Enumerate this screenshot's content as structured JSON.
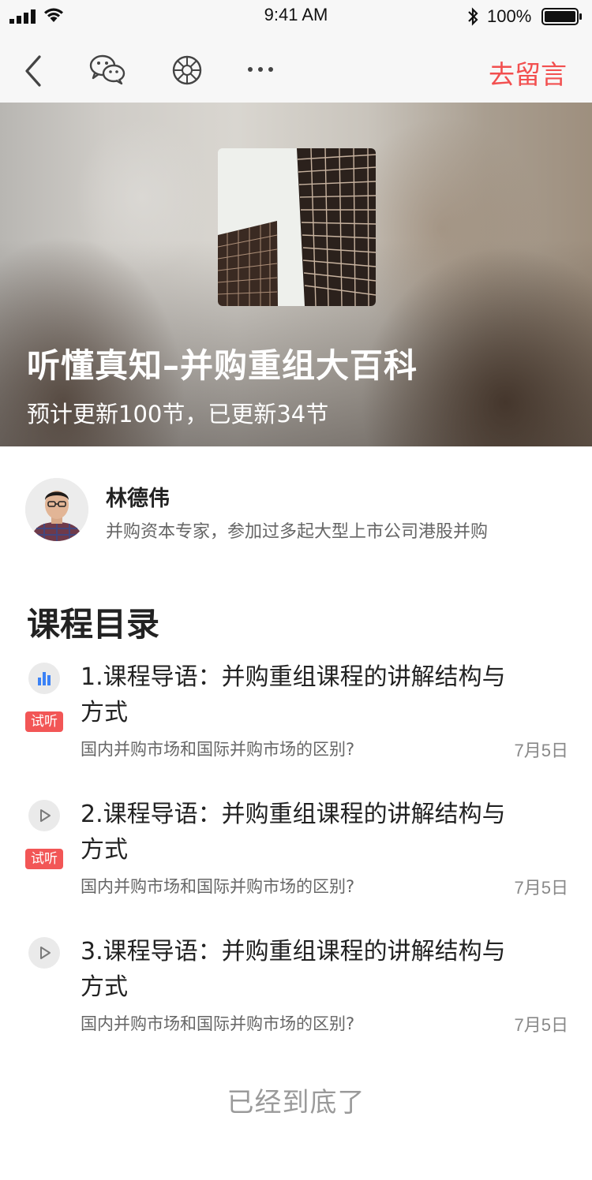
{
  "status_bar": {
    "time": "9:41 AM",
    "battery": "100%",
    "icons": [
      "signal-icon",
      "wifi-icon",
      "bluetooth-icon",
      "battery-icon"
    ]
  },
  "nav": {
    "icons": [
      "back-icon",
      "wechat-icon",
      "moments-icon",
      "more-icon"
    ],
    "comment_label": "去留言",
    "accent_color": "#f24f4f"
  },
  "course": {
    "title": "听懂真知–并购重组大百科",
    "progress_text": "预计更新100节，已更新34节"
  },
  "author": {
    "name": "林德伟",
    "description": "并购资本专家，参加过多起大型上市公司港股并购"
  },
  "catalog": {
    "title": "课程目录",
    "lessons": [
      {
        "icon": "playing-bars-icon",
        "tag": "试听",
        "title": "1.课程导语：并购重组课程的讲解结构与方式",
        "description": "国内并购市场和国际并购市场的区别?",
        "date": "7月5日"
      },
      {
        "icon": "play-icon",
        "tag": "试听",
        "title": "2.课程导语：并购重组课程的讲解结构与方式",
        "description": "国内并购市场和国际并购市场的区别?",
        "date": "7月5日"
      },
      {
        "icon": "play-icon",
        "tag": "",
        "title": "3.课程导语：并购重组课程的讲解结构与方式",
        "description": "国内并购市场和国际并购市场的区别?",
        "date": "7月5日"
      }
    ]
  },
  "footer": {
    "end_text": "已经到底了"
  }
}
